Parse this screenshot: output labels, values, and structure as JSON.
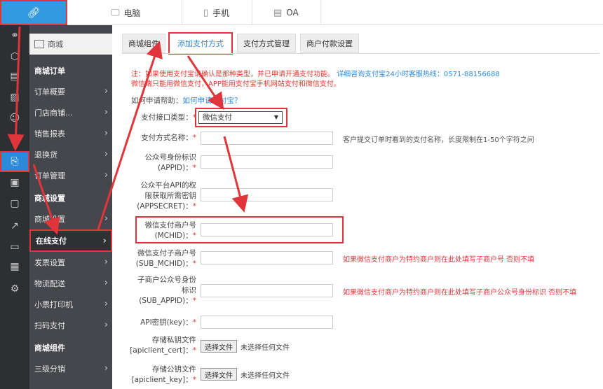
{
  "topbar": {
    "logo_icon": "link-icon",
    "tabs": [
      {
        "icon": "monitor-icon",
        "label": "电脑"
      },
      {
        "icon": "phone-icon",
        "label": "手机"
      },
      {
        "icon": "document-icon",
        "label": "OA"
      }
    ]
  },
  "iconbar": {
    "items": [
      "link-icon",
      "cube-icon",
      "document-icon",
      "image-icon",
      "user-icon",
      "share-icon",
      "clipboard-icon",
      "store-icon",
      "briefcase-icon",
      "chart-icon",
      "id-card-icon",
      "grid-icon",
      "gear-icon"
    ],
    "active_index": 6
  },
  "sidebar": {
    "shop_label": "商城",
    "items": [
      {
        "label": "商城订单",
        "type": "head"
      },
      {
        "label": "订单概要"
      },
      {
        "label": "门店商铺..."
      },
      {
        "label": "销售报表"
      },
      {
        "label": "退换货"
      },
      {
        "label": "订单管理"
      },
      {
        "label": "商城设置",
        "type": "head"
      },
      {
        "label": "商城设置"
      },
      {
        "label": "在线支付",
        "active": true
      },
      {
        "label": "发票设置"
      },
      {
        "label": "物流配送"
      },
      {
        "label": "小票打印机"
      },
      {
        "label": "扫码支付"
      },
      {
        "label": "商城组件",
        "type": "head"
      },
      {
        "label": "三级分销"
      }
    ]
  },
  "main": {
    "tabs": [
      "商城组件",
      "添加支付方式",
      "支付方式管理",
      "商户付款设置"
    ],
    "active_tab": 1,
    "note_prefix": "注：如果使用支付宝请确认是那种类型，并已申请开通支付功能。",
    "note_link": "详细咨询支付宝24小时客服热线：0571-88156688",
    "note2": "微信端只能用微信支付，APP能用支付宝手机网站支付和微信支付。",
    "help_label": "如何申请帮助：",
    "help_link": "如何申请支付宝？",
    "required_mark": "*",
    "fields": {
      "type_label": "支付接口类型：",
      "type_value": "微信支付",
      "name_label": "支付方式名称：",
      "name_hint": "客户提交订单时看到的支付名称，长度限制在1-50个字符之间",
      "appid_label1": "公众号身份标识",
      "appid_label2": "(APPID)：",
      "secret_label1": "公众平台API的权",
      "secret_label2": "限获取所需密钥",
      "secret_label3": "(APPSECRET)：",
      "mchid_label1": "微信支付商户号",
      "mchid_label2": "(MCHID)：",
      "submchid_label1": "微信支付子商户号",
      "submchid_label2": "(SUB_MCHID)：",
      "submchid_hint": "如果微信支付商户为特约商户则在此处填写子商户号 否则不填",
      "subappid_label1": "子商户公众号身份",
      "subappid_label2": "标识",
      "subappid_label3": "(SUB_APPID)：",
      "subappid_hint": "如果微信支付商户为特约商户则在此处填写子商户公众号身份标识 否则不填",
      "apikey_label": "API密钥(key)：",
      "cert_label1": "存储私钥文件",
      "cert_label2": "[apiclient_cert]：",
      "key_label1": "存储公钥文件",
      "key_label2": "[apiclient_key]：",
      "file_button": "选择文件",
      "file_none": "未选择任何文件"
    }
  },
  "colors": {
    "accent": "#2d8ad9",
    "annotation": "#e0353b",
    "sidebar": "#45474c",
    "iconbar": "#2d2f33"
  }
}
